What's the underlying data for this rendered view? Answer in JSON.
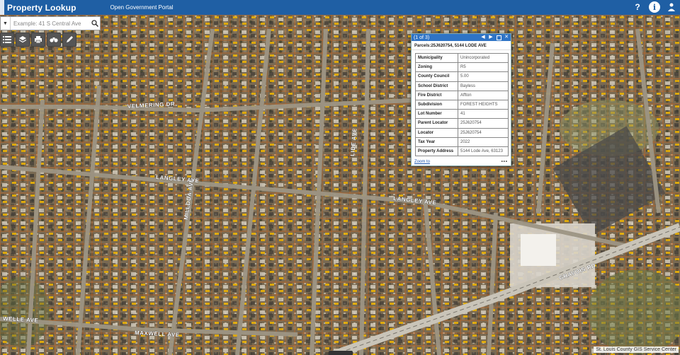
{
  "header": {
    "title": "Property Lookup",
    "portal_link": "Open Government Portal",
    "icons": [
      "question-icon",
      "info-icon",
      "user-icon"
    ]
  },
  "search": {
    "placeholder": "Example: 41 S Central Ave"
  },
  "toolbar": {
    "buttons": [
      "list-icon",
      "layers-icon",
      "print-icon",
      "binoculars-icon",
      "pencil-icon"
    ]
  },
  "popup": {
    "counter": "(1 of 3)",
    "parcel_title": "Parcels:25J620754, 5144 LODE AVE",
    "attributes": [
      {
        "key": "Municipality",
        "value": "Unincorporated"
      },
      {
        "key": "Zoning",
        "value": "R5"
      },
      {
        "key": "County Council",
        "value": "5.00"
      },
      {
        "key": "School District",
        "value": "Bayless"
      },
      {
        "key": "Fire District",
        "value": "Affton"
      },
      {
        "key": "Subdivision",
        "value": "FOREST HEIGHTS"
      },
      {
        "key": "Lot Number",
        "value": "41"
      },
      {
        "key": "Parent Locator",
        "value": "25J620754"
      },
      {
        "key": "Locator",
        "value": "25J620754"
      },
      {
        "key": "Tax Year",
        "value": "2022"
      },
      {
        "key": "Property Address",
        "value": "5144 Lode Ave, 63123"
      }
    ],
    "zoom_link": "Zoom to",
    "more": "•••"
  },
  "map": {
    "streets": [
      "VELMERING DR",
      "LANGLEY AVE",
      "LANGLEY AVE",
      "GRAVOIS RD",
      "WELLE AVE",
      "MAXWELL AVE",
      "MILLDUA AVE",
      "LIDE AVE"
    ],
    "credit": "St. Louis County GIS Service Center"
  },
  "colors": {
    "header": "#1f5fa4",
    "popup_title": "#2f74c5",
    "parcel_lines": "#c8641e",
    "parcel_labels": "#f0b400"
  }
}
